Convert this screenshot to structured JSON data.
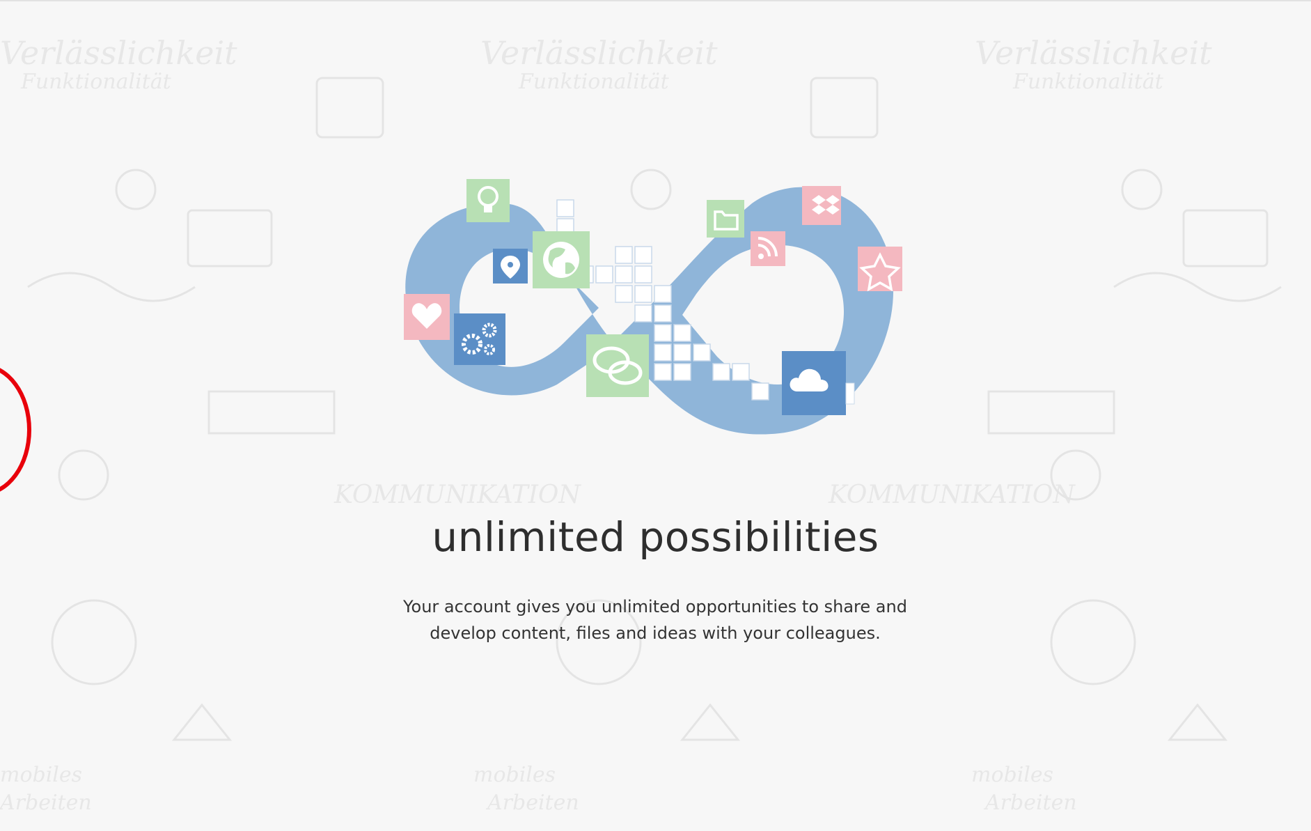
{
  "hero": {
    "title": "unlimited possibilities",
    "description_line1": "Your account gives you unlimited opportunities to share and",
    "description_line2": "develop content, files and ideas with your colleagues."
  },
  "background_doodle_words": {
    "reliability": "Verlässlichkeit",
    "functionality": "Funktionalität",
    "communication": "KOMMUNIKATION",
    "mobile": "mobiles",
    "working": "Arbeiten"
  },
  "illustration": {
    "icons": [
      "lightbulb-icon",
      "location-pin-icon",
      "globe-icon",
      "heart-icon",
      "gears-icon",
      "chat-bubbles-icon",
      "folder-icon",
      "rss-icon",
      "dropbox-icon",
      "star-icon",
      "cloud-icon"
    ]
  },
  "colors": {
    "infinity_blue": "#8fb5d9",
    "tile_green": "#b8e0b4",
    "tile_pink": "#f4b8c0",
    "tile_blue": "#5b8ec6",
    "annotation_red": "#e8000b",
    "background": "#f7f7f7"
  }
}
